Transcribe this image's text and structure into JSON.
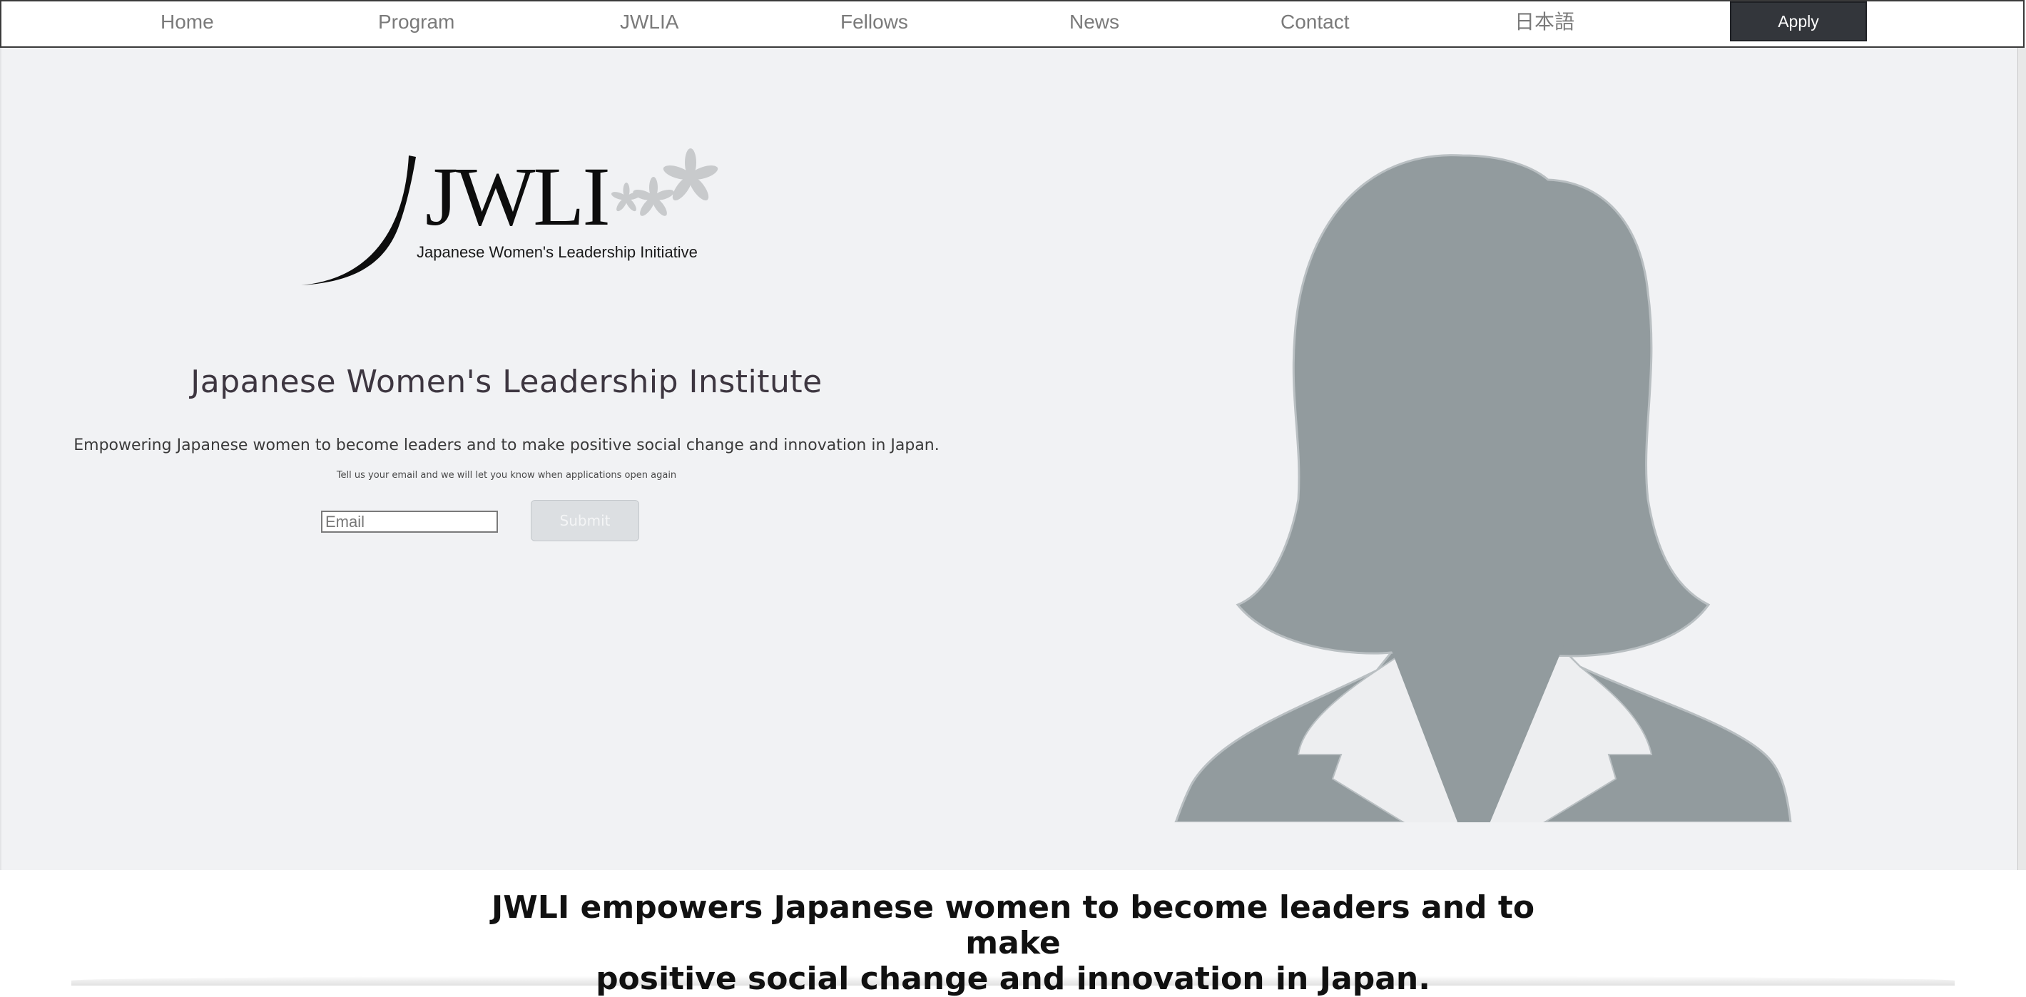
{
  "nav": {
    "items": [
      {
        "label": "Home"
      },
      {
        "label": "Program"
      },
      {
        "label": "JWLIA"
      },
      {
        "label": "Fellows"
      },
      {
        "label": "News"
      },
      {
        "label": "Contact"
      },
      {
        "label": "日本語"
      }
    ],
    "apply_label": "Apply"
  },
  "logo": {
    "wordmark": "JWLI",
    "tagline": "Japanese Women's Leadership Initiative"
  },
  "hero": {
    "title": "Japanese Women's Leadership Institute",
    "subtitle": "Empowering Japanese women to become leaders and to make positive social change and innovation in Japan.",
    "notify_text": "Tell us your email and we will let you know when applications open again",
    "email_placeholder": "Email",
    "submit_label": "Submit"
  },
  "tagline": {
    "line1": "JWLI empowers Japanese women to become leaders and to make",
    "line2": "positive social change and innovation in Japan."
  },
  "colors": {
    "apply_bg": "#33363b",
    "hero_bg": "#f1f2f4",
    "silhouette": "#929b9e"
  }
}
